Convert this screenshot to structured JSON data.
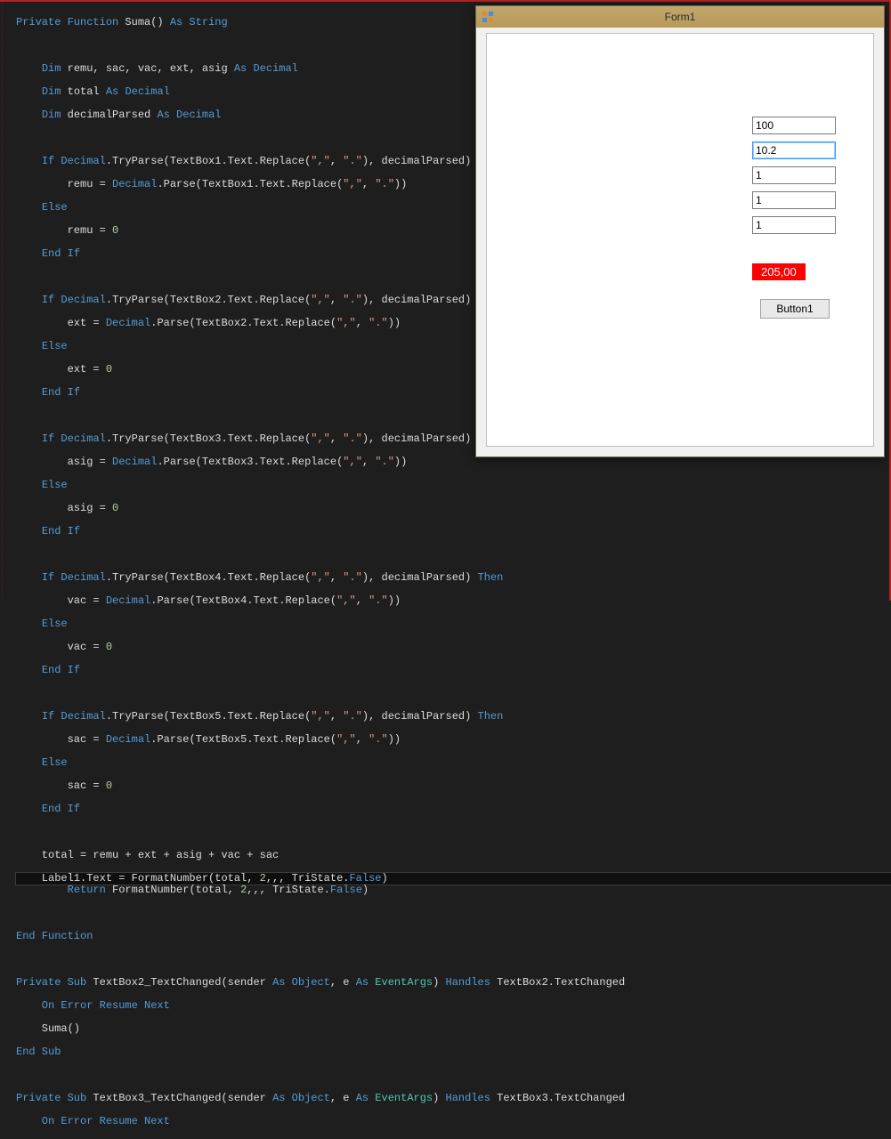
{
  "code": {
    "l1a": "Private Function",
    "l1b": " Suma() ",
    "l1c": "As String",
    "l2a": "Dim",
    "l2b": " remu, sac, vac, ext, asig ",
    "l2c": "As Decimal",
    "l3a": "Dim",
    "l3b": " total ",
    "l3c": "As Decimal",
    "l4a": "Dim",
    "l4b": " decimalParsed ",
    "l4c": "As Decimal",
    "if1": "If Decimal",
    "if1b": ".TryParse(TextBox1.Text.Replace(",
    "if1s1": "\",\"",
    "if1c": ", ",
    "if1s2": "\".\"",
    "if1d": "), decimalParsed) ",
    "then": "Then",
    "asg1": "        remu = ",
    "dec": "Decimal",
    "asg1b": ".Parse(TextBox1.Text.Replace(",
    "cm": "\",\"",
    "sep": ", ",
    "dt": "\".\"",
    "close": "))",
    "else": "Else",
    "z1": "        remu = ",
    "zero": "0",
    "endif": "End If",
    "if2": "If Decimal",
    "if2b": ".TryParse(TextBox2.Text.Replace(",
    "if2d": "), decimalParsed) ",
    "asg2": "        ext = ",
    "asg2b": ".Parse(TextBox2.Text.Replace(",
    "z2": "        ext = ",
    "if3": "If Decimal",
    "if3b": ".TryParse(TextBox3.Text.Replace(",
    "asg3": "        asig = ",
    "asg3b": ".Parse(TextBox3.Text.Replace(",
    "z3": "        asig = ",
    "if4": "If Decimal",
    "if4b": ".TryParse(TextBox4.Text.Replace(",
    "asg4": "        vac = ",
    "asg4b": ".Parse(TextBox4.Text.Replace(",
    "z4": "        vac = ",
    "if5": "If Decimal",
    "if5b": ".TryParse(TextBox5.Text.Replace(",
    "asg5": "        sac = ",
    "asg5b": ".Parse(TextBox5.Text.Replace(",
    "z5": "        sac = ",
    "tot": "    total = remu + ext + asig + vac + sac",
    "lbl1": "    Label1.Text = FormatNumber(total, ",
    "two": "2",
    "lbl2": ",,, TriState.",
    "false": "False",
    "lbl3": ")",
    "ret1": "    Return",
    "ret2": " FormatNumber(total, ",
    "ret3": ",,, TriState.",
    "endfn": "End Function",
    "sub2a": "Private Sub",
    "sub2b": " TextBox2_TextChanged(sender ",
    "as": "As",
    "obj": " Object",
    "sub2c": ", e ",
    "evargs": " EventArgs",
    "sub2d": ") ",
    "handles": "Handles",
    "sub2e": " TextBox2.TextChanged",
    "onerr": "    On Error Resume Next",
    "suma": "    Suma()",
    "endsub": "End Sub",
    "sub3a": "Private Sub",
    "sub3b": " TextBox3_TextChanged(sender ",
    "sub3e": " TextBox3.TextChanged"
  },
  "form": {
    "title": "Form1",
    "tb1": "100",
    "tb2": "10.2",
    "tb3": "1",
    "tb4": "1",
    "tb5": "1",
    "result": "205,00",
    "button": "Button1"
  }
}
